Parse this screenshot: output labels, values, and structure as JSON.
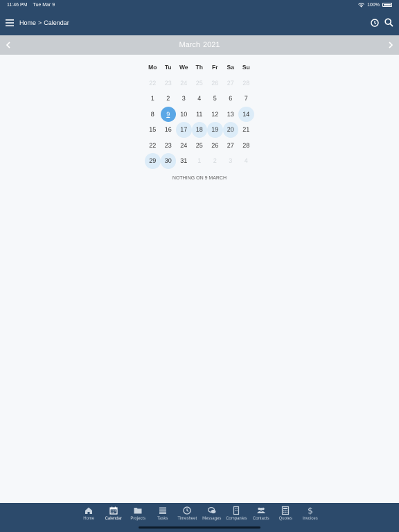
{
  "status_bar": {
    "time": "11:46 PM",
    "date": "Tue Mar 9",
    "battery": "100%"
  },
  "nav": {
    "breadcrumb_home": "Home",
    "breadcrumb_sep": ">",
    "breadcrumb_current": "Calendar"
  },
  "month_header": {
    "month": "March",
    "year": "2021"
  },
  "calendar": {
    "weekday_headers": [
      "Mo",
      "Tu",
      "We",
      "Th",
      "Fr",
      "Sa",
      "Su"
    ],
    "weeks": [
      [
        {
          "d": "22",
          "s": "muted"
        },
        {
          "d": "23",
          "s": "muted"
        },
        {
          "d": "24",
          "s": "muted"
        },
        {
          "d": "25",
          "s": "muted"
        },
        {
          "d": "26",
          "s": "muted"
        },
        {
          "d": "27",
          "s": "muted"
        },
        {
          "d": "28",
          "s": "muted"
        }
      ],
      [
        {
          "d": "1",
          "s": ""
        },
        {
          "d": "2",
          "s": ""
        },
        {
          "d": "3",
          "s": ""
        },
        {
          "d": "4",
          "s": ""
        },
        {
          "d": "5",
          "s": ""
        },
        {
          "d": "6",
          "s": ""
        },
        {
          "d": "7",
          "s": ""
        }
      ],
      [
        {
          "d": "8",
          "s": ""
        },
        {
          "d": "9",
          "s": "selected"
        },
        {
          "d": "10",
          "s": ""
        },
        {
          "d": "11",
          "s": ""
        },
        {
          "d": "12",
          "s": ""
        },
        {
          "d": "13",
          "s": ""
        },
        {
          "d": "14",
          "s": "event"
        }
      ],
      [
        {
          "d": "15",
          "s": ""
        },
        {
          "d": "16",
          "s": ""
        },
        {
          "d": "17",
          "s": "event"
        },
        {
          "d": "18",
          "s": "event"
        },
        {
          "d": "19",
          "s": "event"
        },
        {
          "d": "20",
          "s": "event"
        },
        {
          "d": "21",
          "s": ""
        }
      ],
      [
        {
          "d": "22",
          "s": ""
        },
        {
          "d": "23",
          "s": ""
        },
        {
          "d": "24",
          "s": ""
        },
        {
          "d": "25",
          "s": ""
        },
        {
          "d": "26",
          "s": ""
        },
        {
          "d": "27",
          "s": ""
        },
        {
          "d": "28",
          "s": ""
        }
      ],
      [
        {
          "d": "29",
          "s": "event"
        },
        {
          "d": "30",
          "s": "event"
        },
        {
          "d": "31",
          "s": ""
        },
        {
          "d": "1",
          "s": "muted"
        },
        {
          "d": "2",
          "s": "muted"
        },
        {
          "d": "3",
          "s": "muted"
        },
        {
          "d": "4",
          "s": "muted"
        }
      ]
    ]
  },
  "empty_message": "NOTHING ON 9 MARCH",
  "tabs": [
    {
      "label": "Home",
      "icon": "home-icon"
    },
    {
      "label": "Calendar",
      "icon": "calendar-icon",
      "active": true
    },
    {
      "label": "Projects",
      "icon": "folder-icon"
    },
    {
      "label": "Tasks",
      "icon": "tasks-icon"
    },
    {
      "label": "Timesheet",
      "icon": "clock-icon"
    },
    {
      "label": "Messages",
      "icon": "chat-icon"
    },
    {
      "label": "Companies",
      "icon": "building-icon"
    },
    {
      "label": "Contacts",
      "icon": "people-icon"
    },
    {
      "label": "Quotes",
      "icon": "calculator-icon"
    },
    {
      "label": "Invoices",
      "icon": "dollar-icon"
    }
  ],
  "colors": {
    "header": "#2c4a6b",
    "month_bar": "#c9cdd1",
    "selected_day": "#5aa7e6",
    "event_day": "#dcecf8"
  }
}
